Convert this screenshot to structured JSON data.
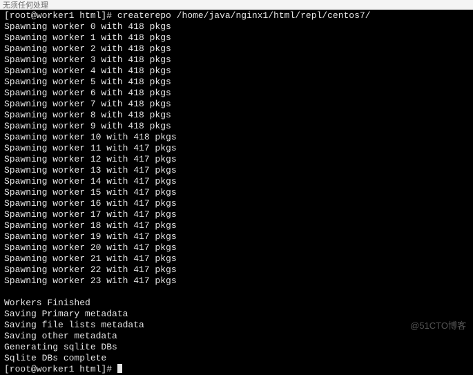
{
  "titlebar": {
    "text": "无须任何处理"
  },
  "terminal": {
    "prompt_user": "root",
    "prompt_host": "worker1",
    "prompt_cwd": "html",
    "command": "createrepo /home/java/nginx1/html/repl/centos7/",
    "workers": [
      {
        "id": 0,
        "pkgs": 418
      },
      {
        "id": 1,
        "pkgs": 418
      },
      {
        "id": 2,
        "pkgs": 418
      },
      {
        "id": 3,
        "pkgs": 418
      },
      {
        "id": 4,
        "pkgs": 418
      },
      {
        "id": 5,
        "pkgs": 418
      },
      {
        "id": 6,
        "pkgs": 418
      },
      {
        "id": 7,
        "pkgs": 418
      },
      {
        "id": 8,
        "pkgs": 418
      },
      {
        "id": 9,
        "pkgs": 418
      },
      {
        "id": 10,
        "pkgs": 418
      },
      {
        "id": 11,
        "pkgs": 417
      },
      {
        "id": 12,
        "pkgs": 417
      },
      {
        "id": 13,
        "pkgs": 417
      },
      {
        "id": 14,
        "pkgs": 417
      },
      {
        "id": 15,
        "pkgs": 417
      },
      {
        "id": 16,
        "pkgs": 417
      },
      {
        "id": 17,
        "pkgs": 417
      },
      {
        "id": 18,
        "pkgs": 417
      },
      {
        "id": 19,
        "pkgs": 417
      },
      {
        "id": 20,
        "pkgs": 417
      },
      {
        "id": 21,
        "pkgs": 417
      },
      {
        "id": 22,
        "pkgs": 417
      },
      {
        "id": 23,
        "pkgs": 417
      }
    ],
    "status_lines": [
      "Workers Finished",
      "Saving Primary metadata",
      "Saving file lists metadata",
      "Saving other metadata",
      "Generating sqlite DBs",
      "Sqlite DBs complete"
    ]
  },
  "watermark": "@51CTO博客"
}
